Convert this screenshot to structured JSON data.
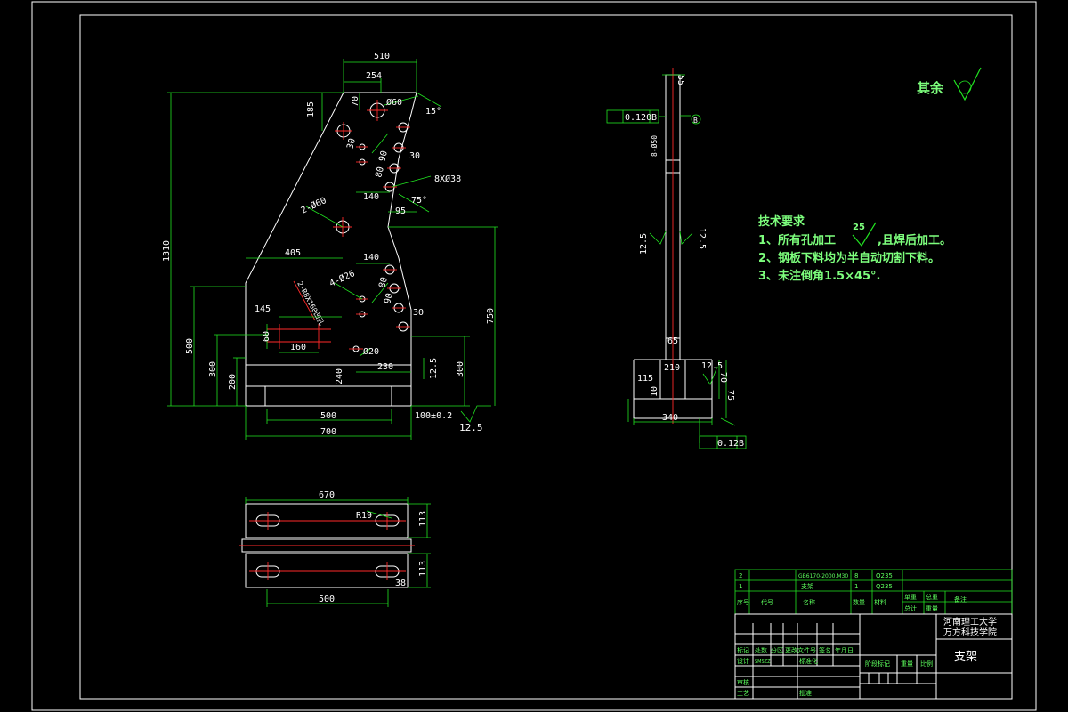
{
  "front_view": {
    "dims": {
      "top_width": "510",
      "top_inner": "254",
      "left_height": "1310",
      "height_500": "500",
      "h_300_left": "300",
      "h_200": "200",
      "h_240": "240",
      "bottom_700": "700",
      "bottom_500": "500",
      "tol_100": "100±0.2",
      "right_750": "750",
      "right_300": "300",
      "w_405": "405",
      "w_145": "145",
      "w_160": "160",
      "w_230": "230",
      "w_140_top": "140",
      "w_140_mid": "140",
      "w_95": "95",
      "v_185": "185",
      "v_70": "70",
      "d_60": "Ø60",
      "v_30a": "30",
      "v_90": "90",
      "v_30b": "30",
      "v_80": "80",
      "hole_8x38": "8XØ38",
      "ang_75": "75°",
      "ang_15": "15°",
      "holes_2x60": "2-Ø60",
      "holes_4x26": "4-Ø26",
      "v_80b": "80",
      "v_90b": "90",
      "v_30c": "30",
      "slot_label": "2-R8X160凹孔",
      "v_60": "60",
      "d_20": "Ø20",
      "rough_125": "12.5"
    }
  },
  "side_view": {
    "dims": {
      "top_55": "55",
      "tol_box": "0.120",
      "datum_box": "B",
      "datum_bubble": "B",
      "slot_50": "8-Ø50",
      "rough_a": "12.5",
      "rough_b": "12.5",
      "v_65": "65",
      "w_210": "210",
      "rough_c": "12.5",
      "v_115": "115",
      "v_10": "10",
      "v_70": "70",
      "v_75": "75",
      "w_340": "340",
      "tol_012": "0.12",
      "datum_b2": "B"
    }
  },
  "bottom_view": {
    "dims": {
      "w_670": "670",
      "r_19": "R19",
      "h_113a": "113",
      "h_113b": "113",
      "h_38": "38",
      "w_500": "500"
    }
  },
  "notes": {
    "other_rough": "其余",
    "title": "技术要求",
    "line1": "1、所有孔加工",
    "line1_rough": "25",
    "line1_tail": ",且焊后加工。",
    "line2": "2、钢板下料均为半自动切割下料。",
    "line3": "3、未注倒角1.5×45°."
  },
  "title_block": {
    "school_line1": "河南理工大学",
    "school_line2": "万方科技学院",
    "part_name": "支架",
    "cells": {
      "r1c1": "2",
      "r1c2": "GB6170-2000.M30",
      "r1c3": "8",
      "r1c4": "Q235",
      "r2c1": "1",
      "r2c2": "支架",
      "r2c3": "1",
      "r2c4": "Q235",
      "h_seq": "序号",
      "h_code": "代号",
      "h_name": "名称",
      "h_qty": "数量",
      "h_mat": "材料",
      "h_unit_w": "单重",
      "h_total_w": "总重",
      "h_total": "总计",
      "h_note": "备注",
      "h_weight": "重量",
      "rev_mark": "标记",
      "rev_count": "处数",
      "rev_zone": "分区",
      "rev_doc": "更改文件号",
      "rev_sign": "签名",
      "rev_date": "年月日",
      "designer": "设计",
      "designer_name": "SMSZZ",
      "std": "标准化",
      "stage": "阶段标记",
      "weight": "重量",
      "scale": "比例",
      "review": "审核",
      "process": "工艺",
      "approve": "批准"
    }
  }
}
